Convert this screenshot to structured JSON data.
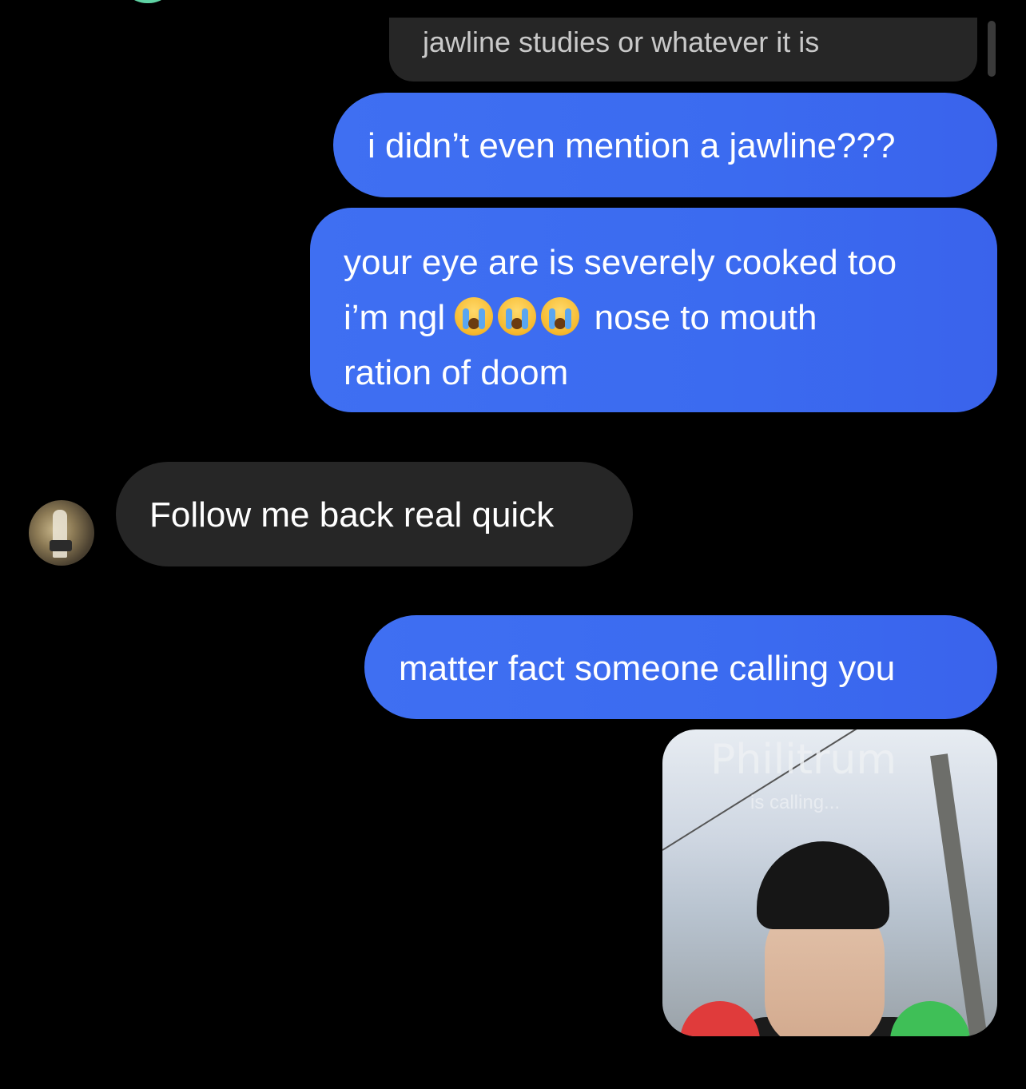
{
  "reply_preview": {
    "text": "jawline studies or whatever it is"
  },
  "messages": [
    {
      "sender": "me",
      "text": "i didn’t even mention a jawline???"
    },
    {
      "sender": "me",
      "line1": "your eye are is severely cooked too",
      "line2_pre": "i’m ngl",
      "line2_post": "nose to mouth",
      "line3": "ration of doom",
      "emojis": [
        "loudly-crying-face-icon",
        "loudly-crying-face-icon",
        "loudly-crying-face-icon"
      ]
    },
    {
      "sender": "them",
      "text": "Follow me back real quick"
    },
    {
      "sender": "me",
      "text": "matter fact someone calling you"
    }
  ],
  "media_message": {
    "overlay_title": "Philitrum",
    "overlay_sub": "is calling..."
  }
}
